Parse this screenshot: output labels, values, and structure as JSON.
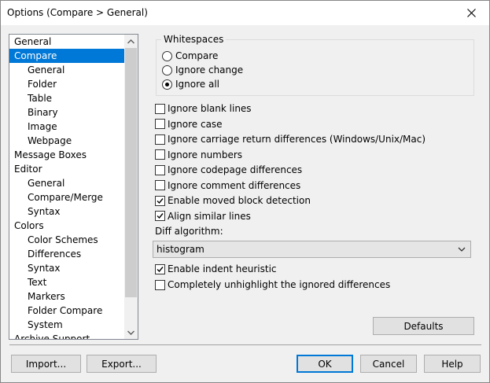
{
  "window": {
    "title": "Options (Compare > General)"
  },
  "tree": {
    "items": [
      {
        "label": "General",
        "level": 0,
        "selected": false
      },
      {
        "label": "Compare",
        "level": 0,
        "selected": true
      },
      {
        "label": "General",
        "level": 1,
        "selected": false
      },
      {
        "label": "Folder",
        "level": 1,
        "selected": false
      },
      {
        "label": "Table",
        "level": 1,
        "selected": false
      },
      {
        "label": "Binary",
        "level": 1,
        "selected": false
      },
      {
        "label": "Image",
        "level": 1,
        "selected": false
      },
      {
        "label": "Webpage",
        "level": 1,
        "selected": false
      },
      {
        "label": "Message Boxes",
        "level": 0,
        "selected": false
      },
      {
        "label": "Editor",
        "level": 0,
        "selected": false
      },
      {
        "label": "General",
        "level": 1,
        "selected": false
      },
      {
        "label": "Compare/Merge",
        "level": 1,
        "selected": false
      },
      {
        "label": "Syntax",
        "level": 1,
        "selected": false
      },
      {
        "label": "Colors",
        "level": 0,
        "selected": false
      },
      {
        "label": "Color Schemes",
        "level": 1,
        "selected": false
      },
      {
        "label": "Differences",
        "level": 1,
        "selected": false
      },
      {
        "label": "Syntax",
        "level": 1,
        "selected": false
      },
      {
        "label": "Text",
        "level": 1,
        "selected": false
      },
      {
        "label": "Markers",
        "level": 1,
        "selected": false
      },
      {
        "label": "Folder Compare",
        "level": 1,
        "selected": false
      },
      {
        "label": "System",
        "level": 1,
        "selected": false
      },
      {
        "label": "Archive Support",
        "level": 0,
        "selected": false
      }
    ]
  },
  "whitespaces": {
    "label": "Whitespaces",
    "options": [
      {
        "label": "Compare",
        "selected": false
      },
      {
        "label": "Ignore change",
        "selected": false
      },
      {
        "label": "Ignore all",
        "selected": true
      }
    ]
  },
  "checks": [
    {
      "label": "Ignore blank lines",
      "checked": false
    },
    {
      "label": "Ignore case",
      "checked": false
    },
    {
      "label": "Ignore carriage return differences (Windows/Unix/Mac)",
      "checked": false
    },
    {
      "label": "Ignore numbers",
      "checked": false
    },
    {
      "label": "Ignore codepage differences",
      "checked": false
    },
    {
      "label": "Ignore comment differences",
      "checked": false
    },
    {
      "label": "Enable moved block detection",
      "checked": true
    },
    {
      "label": "Align similar lines",
      "checked": true
    }
  ],
  "diff": {
    "label": "Diff algorithm:",
    "value": "histogram"
  },
  "checks2": [
    {
      "label": "Enable indent heuristic",
      "checked": true
    },
    {
      "label": "Completely unhighlight the ignored differences",
      "checked": false
    }
  ],
  "buttons": {
    "defaults": "Defaults",
    "import": "Import...",
    "export": "Export...",
    "ok": "OK",
    "cancel": "Cancel",
    "help": "Help"
  },
  "colors": {
    "selection": "#0078d7",
    "window_bg": "#f0f0f0"
  }
}
